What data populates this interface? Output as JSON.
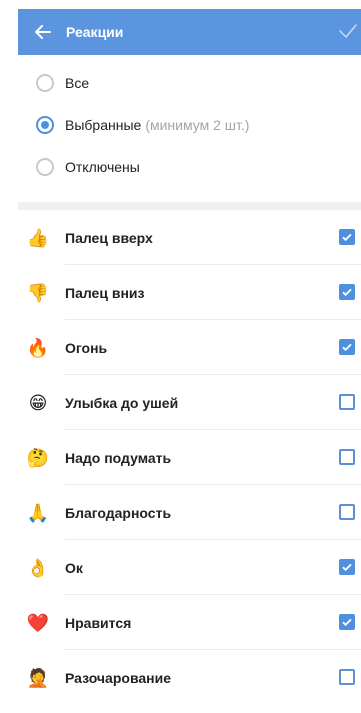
{
  "header": {
    "title": "Реакции",
    "back_icon": "arrow-left-icon",
    "confirm_icon": "check-icon"
  },
  "mode": {
    "options": [
      {
        "label": "Все",
        "hint": "",
        "selected": false
      },
      {
        "label": "Выбранные",
        "hint": "(минимум 2 шт.)",
        "selected": true
      },
      {
        "label": "Отключены",
        "hint": "",
        "selected": false
      }
    ]
  },
  "reactions": [
    {
      "name": "Палец вверх",
      "emoji": "👍",
      "checked": true
    },
    {
      "name": "Палец вниз",
      "emoji": "👎",
      "checked": true
    },
    {
      "name": "Огонь",
      "emoji": "🔥",
      "checked": true
    },
    {
      "name": "Улыбка до ушей",
      "emoji": "😁",
      "checked": false
    },
    {
      "name": "Надо подумать",
      "emoji": "🤔",
      "checked": false
    },
    {
      "name": "Благодарность",
      "emoji": "🙏",
      "checked": false
    },
    {
      "name": "Ок",
      "emoji": "👌",
      "checked": true
    },
    {
      "name": "Нравится",
      "emoji": "❤️",
      "checked": true
    },
    {
      "name": "Разочарование",
      "emoji": "🤦",
      "checked": false
    }
  ],
  "colors": {
    "accent": "#4e8fe0",
    "appbar": "#5b95e0"
  }
}
